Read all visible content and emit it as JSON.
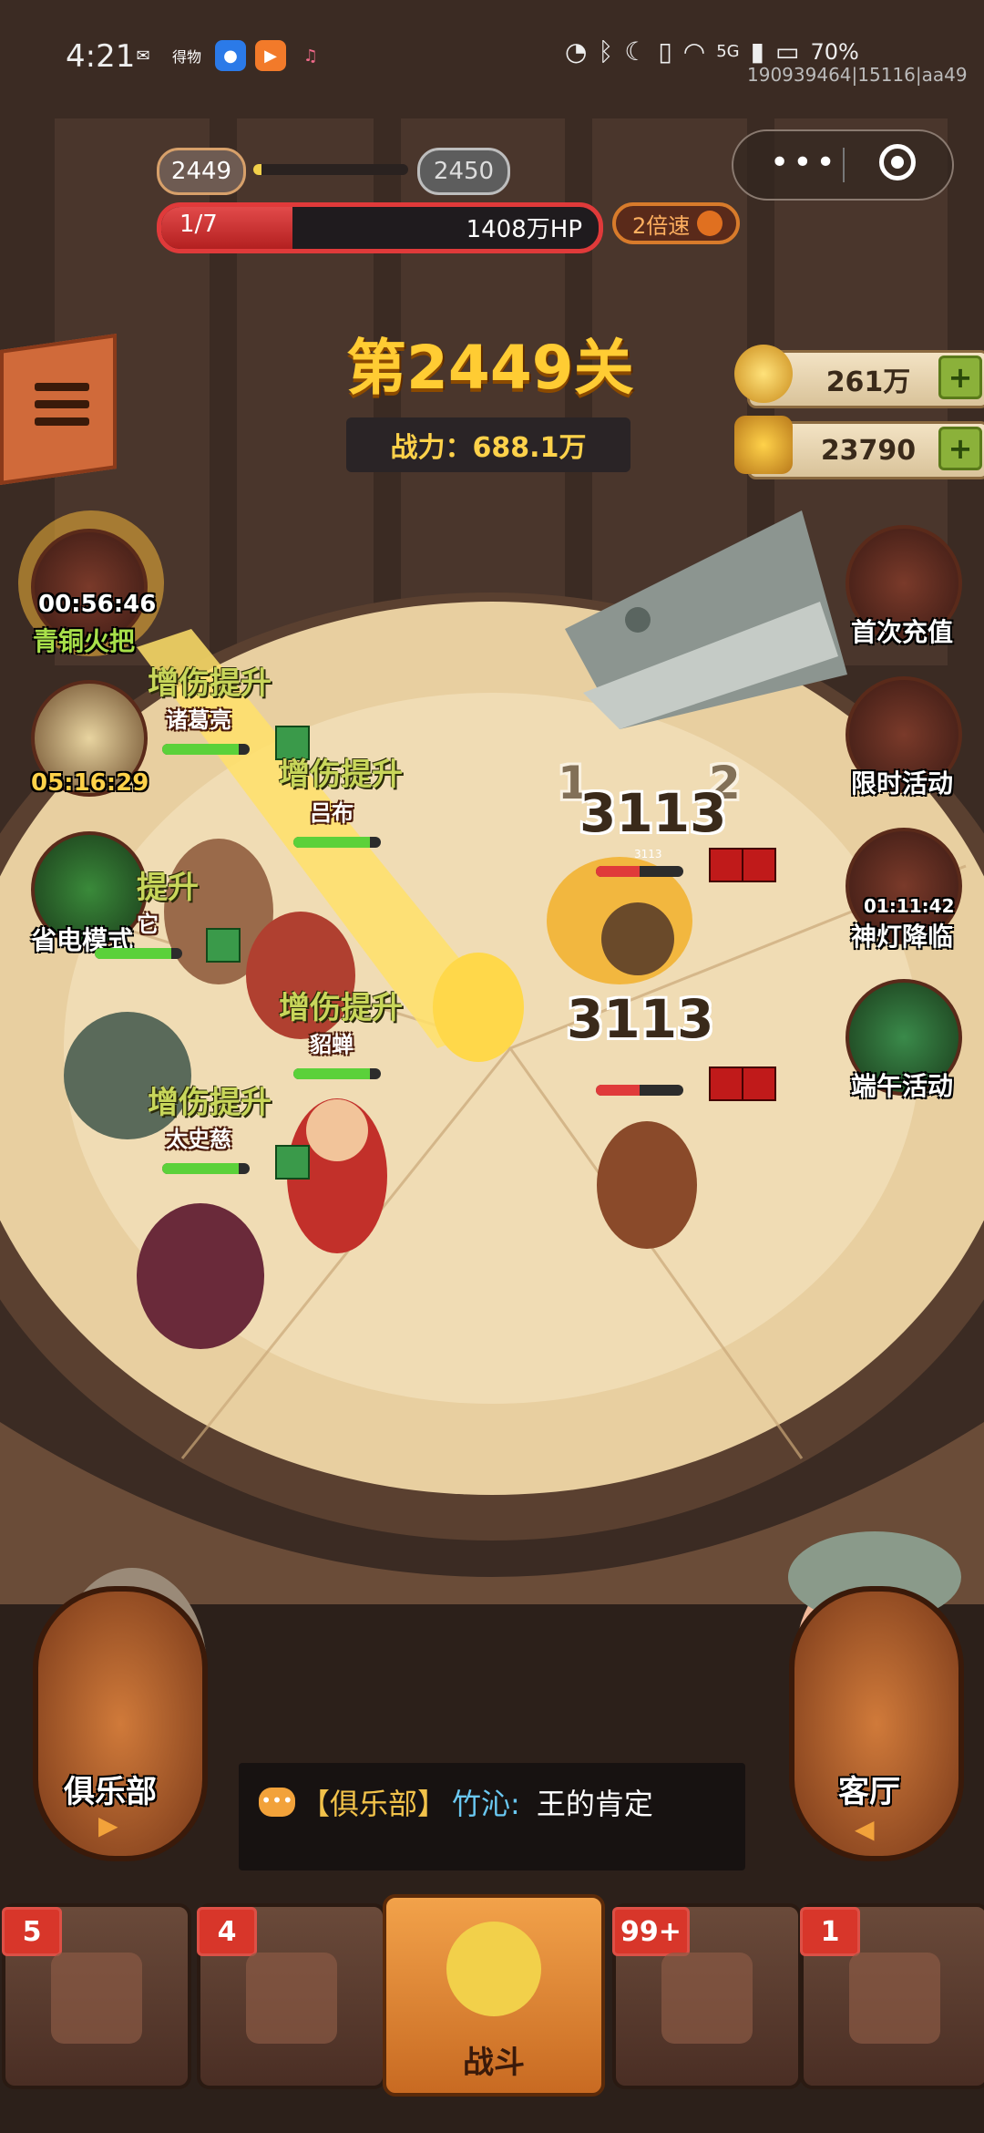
{
  "status_bar": {
    "time": "4:21",
    "app_icons": [
      "wechat-icon",
      "weibo-text",
      "app-blue-icon",
      "app-orange-icon",
      "app-pink-icon"
    ],
    "weibo_text": "得物",
    "battery": "70%",
    "network": "5G",
    "uid_watermark": "190939464|15116|aa49"
  },
  "level": {
    "current": "2449",
    "next": "2450",
    "progress_fraction": 0.05
  },
  "hp": {
    "wave": "1/7",
    "hp_text": "1408万HP",
    "fill_fraction": 0.3
  },
  "speed_label": "2倍速",
  "stage_title": "第2449关",
  "power_text": "战力：688.1万",
  "currency": {
    "coins": "261万",
    "gold": "23790"
  },
  "left_side": {
    "torch_timer": "00:56:46",
    "torch_label": "青铜火把",
    "book_timer": "05:16:29",
    "power_save_label": "省电模式"
  },
  "right_side": {
    "first_recharge": "首次充值",
    "limited_event": "限时活动",
    "lamp_timer": "01:11:42",
    "lamp_event": "神灯降临",
    "dragon_boat": "端午活动"
  },
  "battle": {
    "buff_text": "增伤提升",
    "buff_partial": "提升",
    "heroes": [
      "诸葛亮",
      "吕布",
      "貂蝉",
      "太史慈"
    ],
    "hero_partial": "它",
    "damage_top": "3113",
    "damage_top_ghost": "1",
    "damage_top_ghost2": "2",
    "damage_mid": "3113",
    "enemy_small_hp": "3113"
  },
  "club_label": "俱乐部",
  "lobby_label": "客厅",
  "chat": {
    "channel": "【俱乐部】",
    "sender": "竹沁:",
    "message": "王的肯定"
  },
  "bottom_nav": [
    {
      "badge": "5",
      "label": ""
    },
    {
      "badge": "4",
      "label": ""
    },
    {
      "badge": "",
      "label": "战斗"
    },
    {
      "badge": "99+",
      "label": ""
    },
    {
      "badge": "1",
      "label": ""
    }
  ],
  "colors": {
    "gold": "#ffcc33",
    "hp_red": "#e03a3a",
    "buff_green": "#c8d65a",
    "badge_red": "#d8362a"
  }
}
